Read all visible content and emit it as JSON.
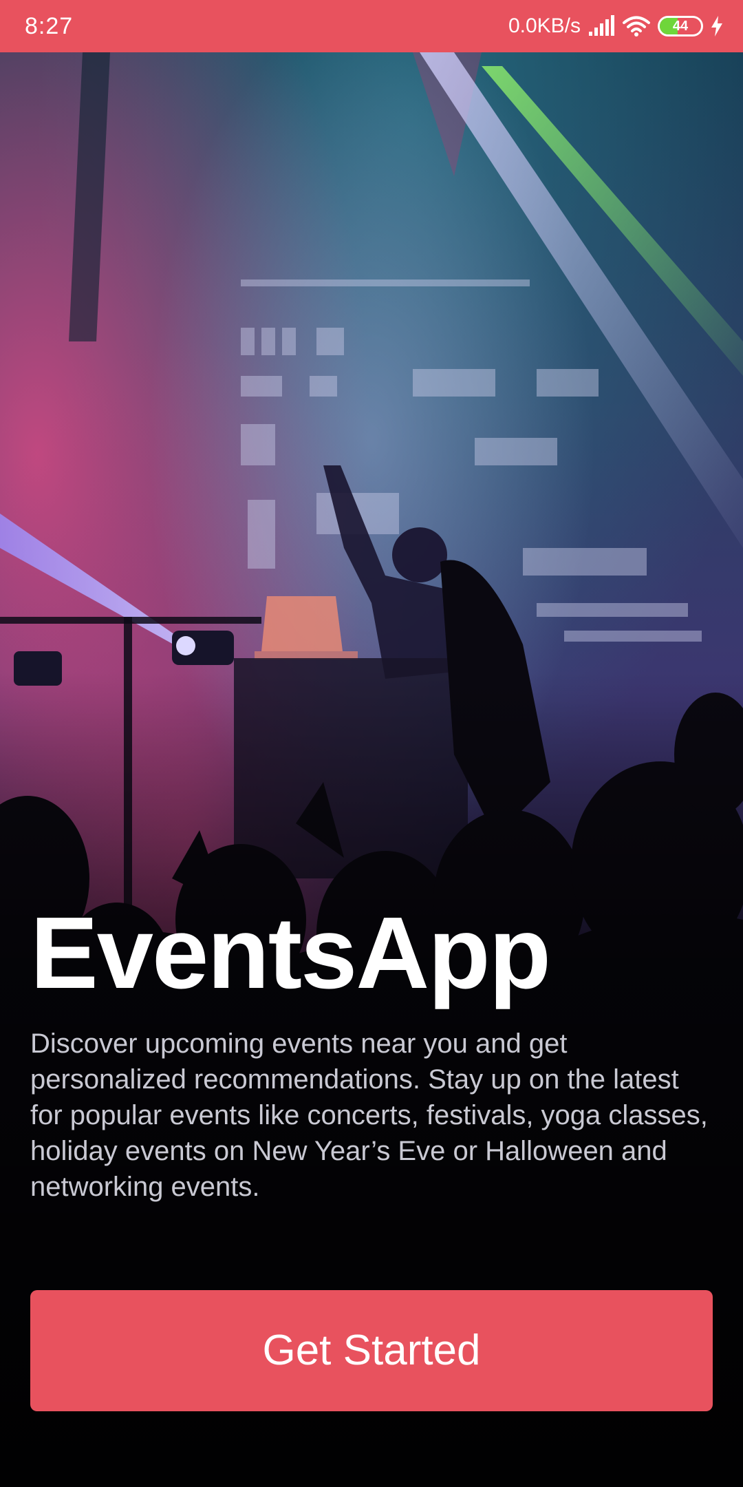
{
  "status_bar": {
    "time": "8:27",
    "network_speed": "0.0KB/s",
    "battery_level": "44",
    "battery_fraction": 0.44,
    "icons": [
      "signal-icon",
      "wifi-icon",
      "battery-icon",
      "charging-icon"
    ],
    "background_color": "#e8525e"
  },
  "hero": {
    "background_image": "concert-crowd-photo",
    "title": "EventsApp",
    "description": "Discover upcoming events near you and get personalized recommendations. Stay up on the latest for popular events like concerts, festivals, yoga classes, holiday events on New Year’s Eve or Halloween and networking events."
  },
  "cta": {
    "label": "Get Started",
    "color": "#e8525e"
  }
}
